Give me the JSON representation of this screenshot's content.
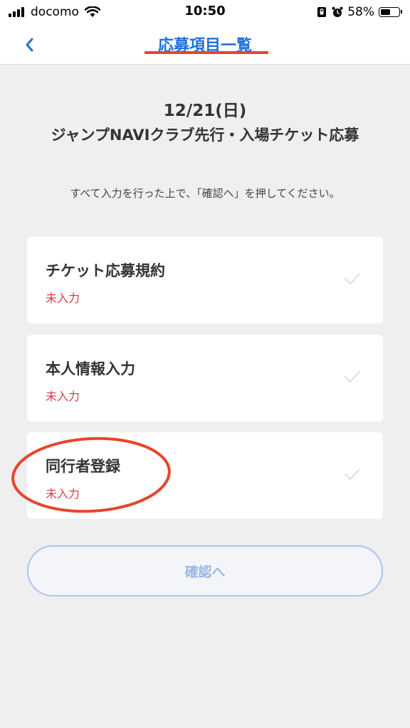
{
  "status_bar": {
    "carrier": "docomo",
    "time": "10:50",
    "battery": "58%",
    "battery_level": 0.58
  },
  "nav": {
    "title": "応募項目一覧",
    "back_icon": "chevron-left-icon",
    "accent_color": "#1f6fe0",
    "underline_color": "#e8452c"
  },
  "header": {
    "date": "12/21(日)",
    "title": "ジャンプNAVIクラブ先行・入場チケット応募",
    "instruction": "すべて入力を行った上で、「確認へ」を押してください。"
  },
  "cards": [
    {
      "title": "チケット応募規約",
      "status": "未入力"
    },
    {
      "title": "本人情報入力",
      "status": "未入力"
    },
    {
      "title": "同行者登録",
      "status": "未入力"
    }
  ],
  "confirm_button": {
    "label": "確認へ"
  },
  "colors": {
    "status_red": "#e0394a",
    "annotation_red": "#e8452c",
    "background": "#efefef"
  }
}
